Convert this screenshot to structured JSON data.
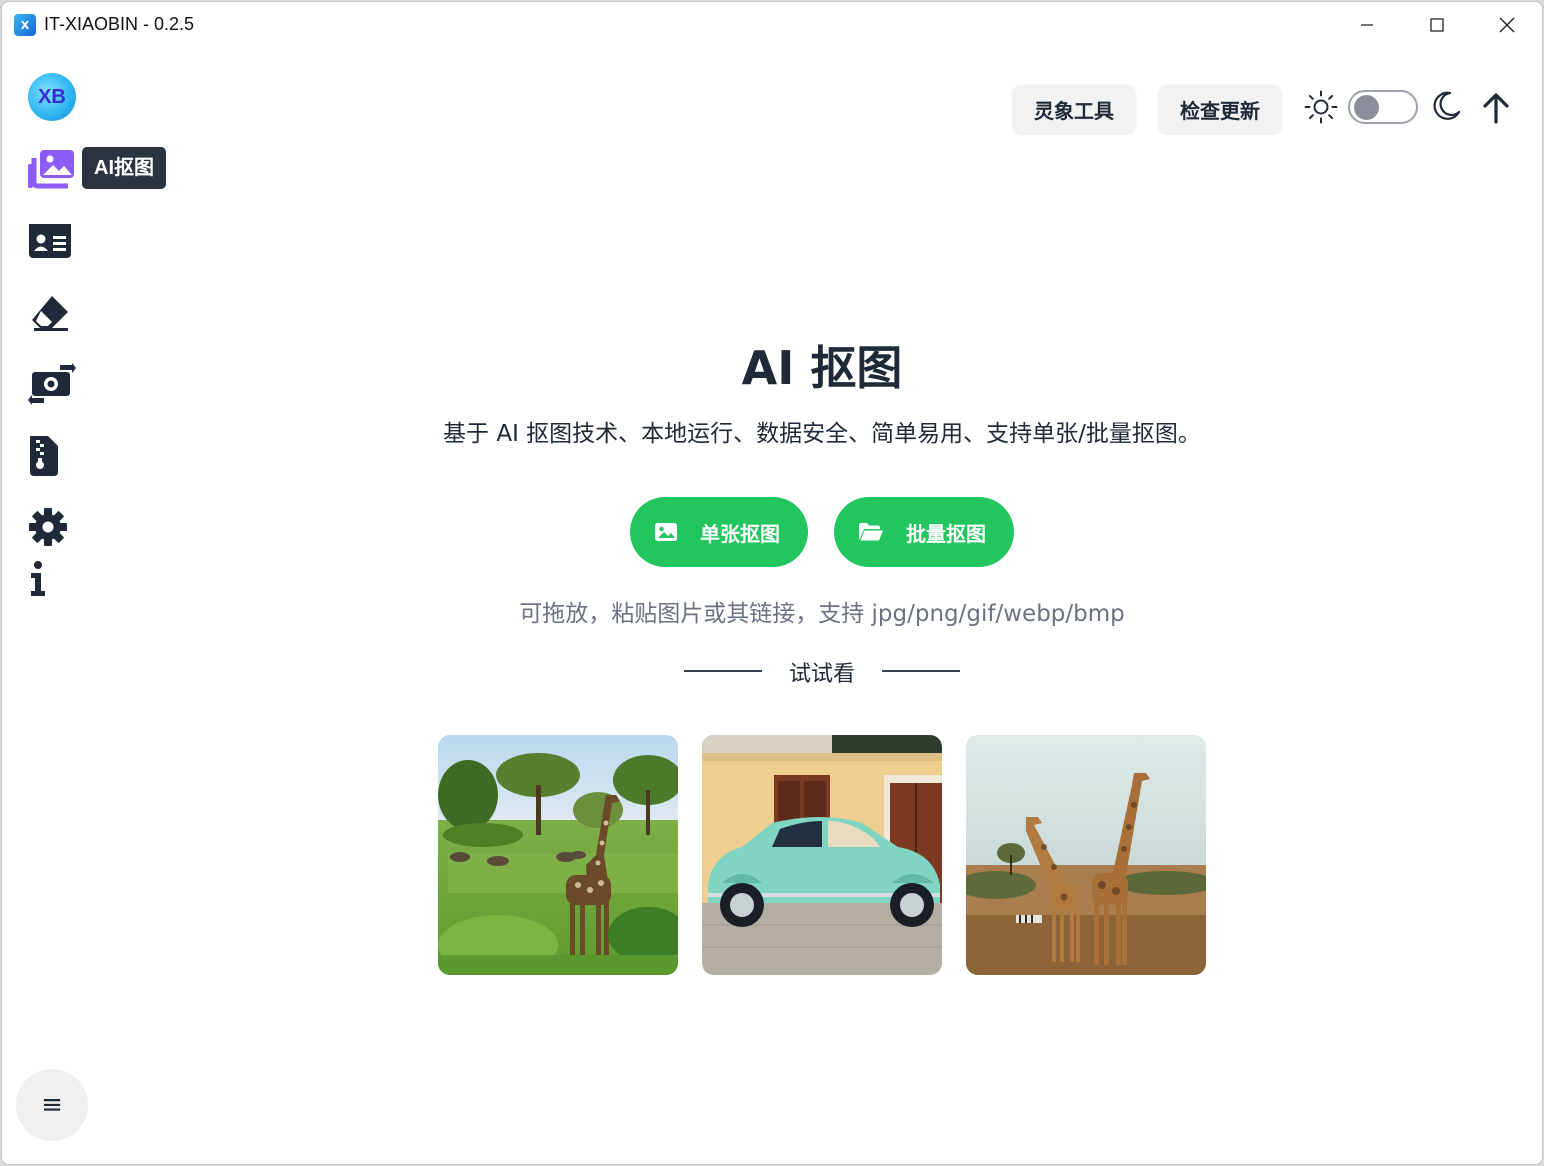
{
  "window": {
    "title": "IT-XIAOBIN - 0.2.5",
    "app_icon_text": "X"
  },
  "sidebar": {
    "logo_text": "XB",
    "tooltip": "AI抠图",
    "items": [
      {
        "name": "ai-matting",
        "icon": "images-icon",
        "color": "#8b5cf6"
      },
      {
        "name": "id-photo",
        "icon": "id-card-icon",
        "color": "#1f2937"
      },
      {
        "name": "eraser",
        "icon": "eraser-icon",
        "color": "#1f2937"
      },
      {
        "name": "convert",
        "icon": "money-bill-transfer-icon",
        "color": "#1f2937"
      },
      {
        "name": "compress",
        "icon": "file-zipper-icon",
        "color": "#1f2937"
      },
      {
        "name": "settings",
        "icon": "gear-icon",
        "color": "#1f2937"
      },
      {
        "name": "about",
        "icon": "info-icon",
        "color": "#1f2937"
      }
    ],
    "menu_glyph": "≡"
  },
  "header": {
    "tools_label": "灵象工具",
    "update_label": "检查更新",
    "theme_dark": false
  },
  "main": {
    "title": "AI 抠图",
    "description": "基于 AI 抠图技术、本地运行、数据安全、简单易用、支持单张/批量抠图。",
    "single_button": "单张抠图",
    "batch_button": "批量抠图",
    "hint": "可拖放，粘贴图片或其链接，支持 jpg/png/gif/webp/bmp",
    "try_label": "试试看",
    "samples": [
      {
        "name": "giraffe-savanna"
      },
      {
        "name": "vintage-car"
      },
      {
        "name": "two-giraffes"
      }
    ]
  },
  "colors": {
    "accent_green": "#22c55e",
    "active_purple": "#8b5cf6",
    "text_dark": "#1f2937",
    "tooltip_bg": "#2b3440"
  }
}
